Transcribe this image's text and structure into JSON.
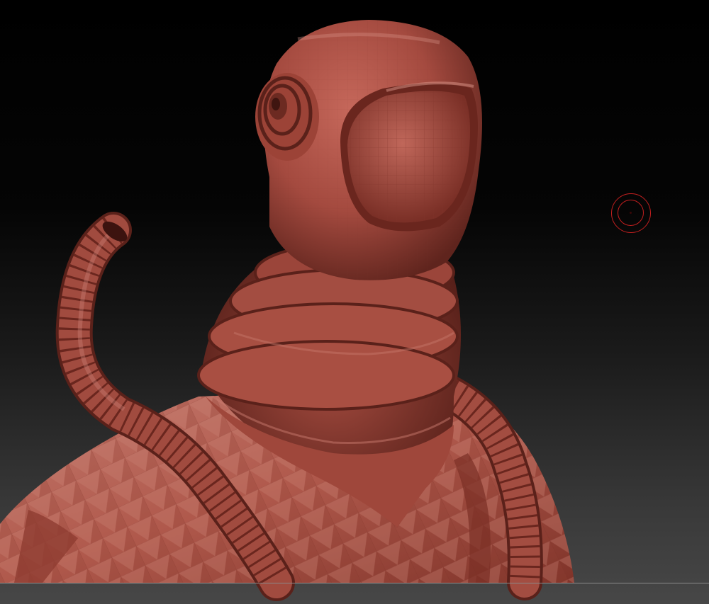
{
  "viewport": {
    "background_top": "#000000",
    "background_bottom": "#474747",
    "model_material": "red-wax"
  },
  "model": {
    "parts": [
      "diving-helmet",
      "visor",
      "round-porthole",
      "ribbed-neck-collar",
      "torso",
      "left-hose",
      "right-hose"
    ],
    "base_color": "#a94a3f",
    "shadow_color": "#5e2019",
    "highlight_color": "#d98a7d"
  },
  "brush_cursor": {
    "icon": "brush-ring-icon",
    "color": "#c11f1f"
  }
}
